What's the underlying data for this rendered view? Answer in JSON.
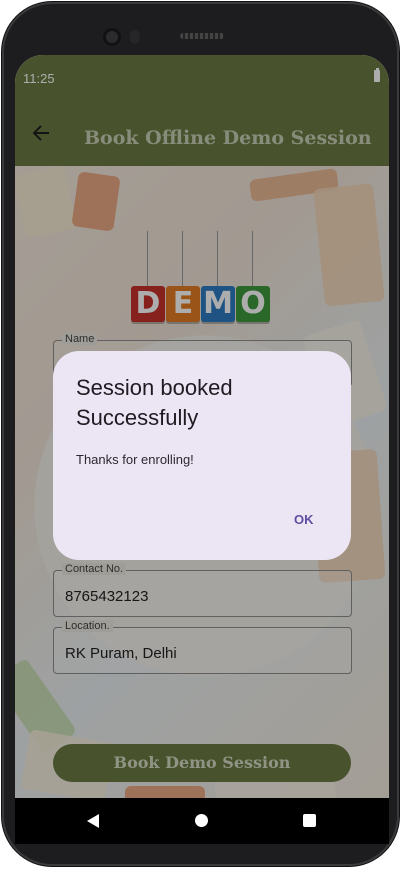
{
  "status_bar": {
    "time": "11:25"
  },
  "app_bar": {
    "title": "Book Offline Demo Session"
  },
  "demo_logo": {
    "letters": [
      "D",
      "E",
      "M",
      "O"
    ]
  },
  "form": {
    "name_label": "Name",
    "contact_label": "Contact No.",
    "contact_value": "8765432123",
    "location_label": "Location.",
    "location_value": "RK Puram, Delhi",
    "submit_label": "Book Demo Session"
  },
  "dialog": {
    "title": "Session booked Successfully",
    "message": "Thanks for enrolling!",
    "ok_label": "OK"
  },
  "colors": {
    "app_bar": "#6b7b45",
    "dialog_bg": "#ece6f4",
    "accent": "#5f4ea0"
  }
}
